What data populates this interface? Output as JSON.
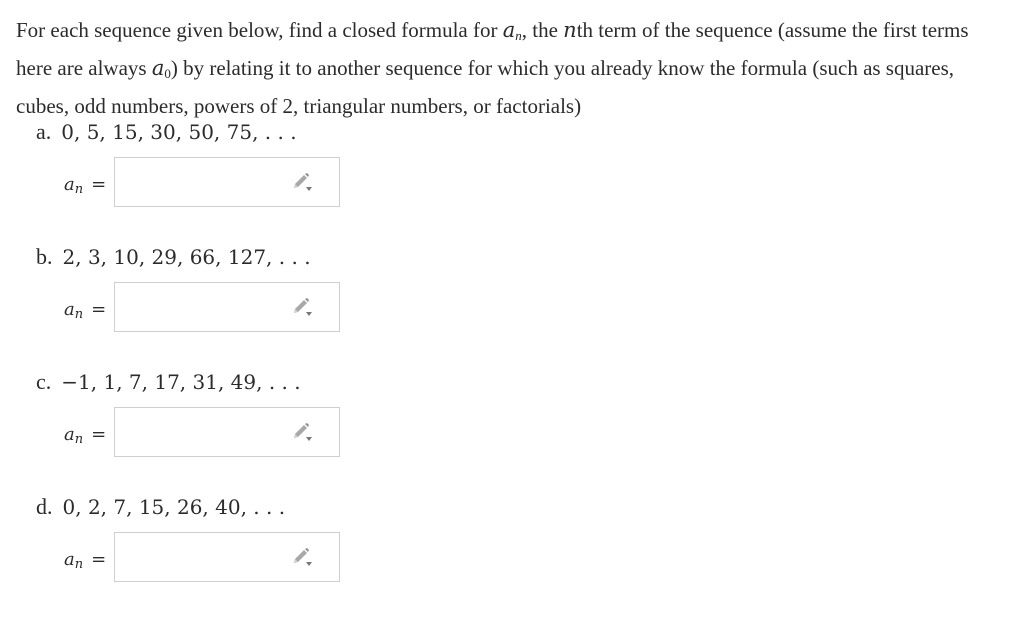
{
  "prompt": {
    "text_1": "For each sequence given below, find a closed formula for ",
    "var": "a",
    "var_sub": "n",
    "text_2": ", the ",
    "nth_var": "n",
    "text_3": "th term of the sequence (assume the first terms here are always ",
    "zero_var": "a",
    "zero_sub": "0",
    "text_4": ") by relating it to another sequence for which you already know the formula (such as squares, cubes, odd numbers, powers of 2, triangular numbers, or factorials)"
  },
  "parts": [
    {
      "letter": "a.",
      "sequence": "0, 5, 15, 30, 50, 75, . . .",
      "answer_var": "a",
      "answer_sub": "n",
      "equals": "=",
      "answer_value": ""
    },
    {
      "letter": "b.",
      "sequence": "2, 3, 10, 29, 66, 127, . . .",
      "answer_var": "a",
      "answer_sub": "n",
      "equals": "=",
      "answer_value": ""
    },
    {
      "letter": "c.",
      "sequence": "−1, 1, 7, 17, 31, 49, . . .",
      "answer_var": "a",
      "answer_sub": "n",
      "equals": "=",
      "answer_value": ""
    },
    {
      "letter": "d.",
      "sequence": "0, 2, 7, 15, 26, 40, . . .",
      "answer_var": "a",
      "answer_sub": "n",
      "equals": "=",
      "answer_value": ""
    }
  ],
  "icons": {
    "edit": "pencil-dropdown-icon"
  },
  "colors": {
    "text": "#2b2b2b",
    "box_border": "#cfcfcf",
    "icon": "#9a9a9a"
  }
}
